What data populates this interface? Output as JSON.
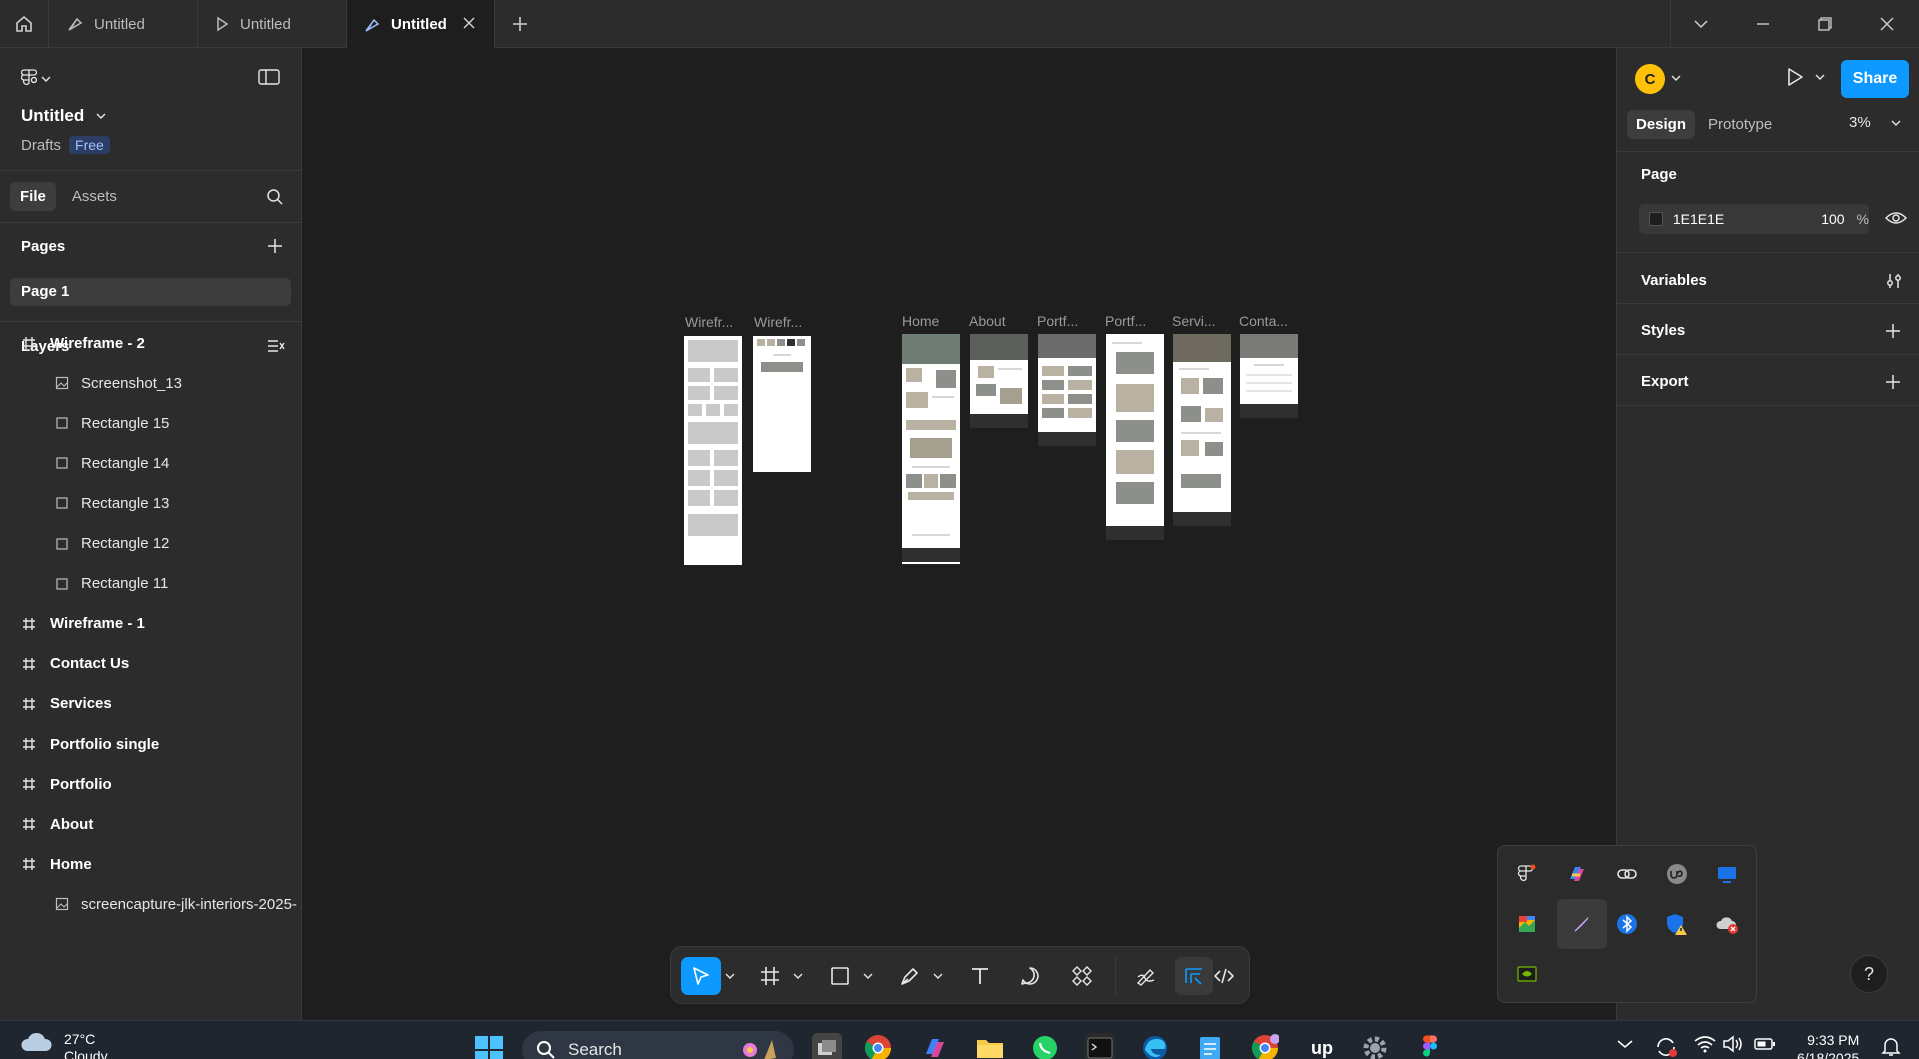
{
  "tabs": [
    {
      "label": "Untitled",
      "kind": "figma"
    },
    {
      "label": "Untitled",
      "kind": "prototype"
    },
    {
      "label": "Untitled",
      "kind": "figma",
      "active": true
    }
  ],
  "file": {
    "title": "Untitled",
    "location": "Drafts",
    "plan": "Free"
  },
  "left_tabs": {
    "file": "File",
    "assets": "Assets"
  },
  "pages": {
    "heading": "Pages",
    "items": [
      "Page 1"
    ]
  },
  "layers": {
    "heading": "Layers",
    "items": [
      {
        "label": "Wireframe - 2",
        "type": "frame"
      },
      {
        "label": "Screenshot_13",
        "type": "image"
      },
      {
        "label": "Rectangle 15",
        "type": "rect"
      },
      {
        "label": "Rectangle 14",
        "type": "rect"
      },
      {
        "label": "Rectangle 13",
        "type": "rect"
      },
      {
        "label": "Rectangle 12",
        "type": "rect"
      },
      {
        "label": "Rectangle 11",
        "type": "rect"
      },
      {
        "label": "Wireframe - 1",
        "type": "frame"
      },
      {
        "label": "Contact Us",
        "type": "frame"
      },
      {
        "label": "Services",
        "type": "frame"
      },
      {
        "label": "Portfolio single",
        "type": "frame"
      },
      {
        "label": "Portfolio",
        "type": "frame"
      },
      {
        "label": "About",
        "type": "frame"
      },
      {
        "label": "Home",
        "type": "frame"
      },
      {
        "label": "screencapture-jlk-interiors-2025-",
        "type": "image"
      }
    ]
  },
  "canvas": {
    "frames": [
      "Wirefr...",
      "Wirefr...",
      "Home",
      "About",
      "Portf...",
      "Portf...",
      "Servi...",
      "Conta..."
    ]
  },
  "right_panel": {
    "avatar_initial": "C",
    "share_label": "Share",
    "tabs": {
      "design": "Design",
      "prototype": "Prototype"
    },
    "zoom": "3%",
    "page_section": "Page",
    "background_hex": "1E1E1E",
    "background_opacity": "100",
    "percent_sign": "%",
    "variables": "Variables",
    "styles": "Styles",
    "export": "Export"
  },
  "help_label": "?",
  "taskbar": {
    "weather_temp": "27°C",
    "weather_desc": "Cloudy",
    "search_placeholder": "Search",
    "time": "9:33 PM",
    "date": "6/18/2025",
    "upwork_label": "up"
  },
  "colors": {
    "accent": "#0d99ff",
    "avatar": "#ffc107",
    "canvas_bg": "#1e1e1e",
    "panel_bg": "#2c2c2c"
  }
}
